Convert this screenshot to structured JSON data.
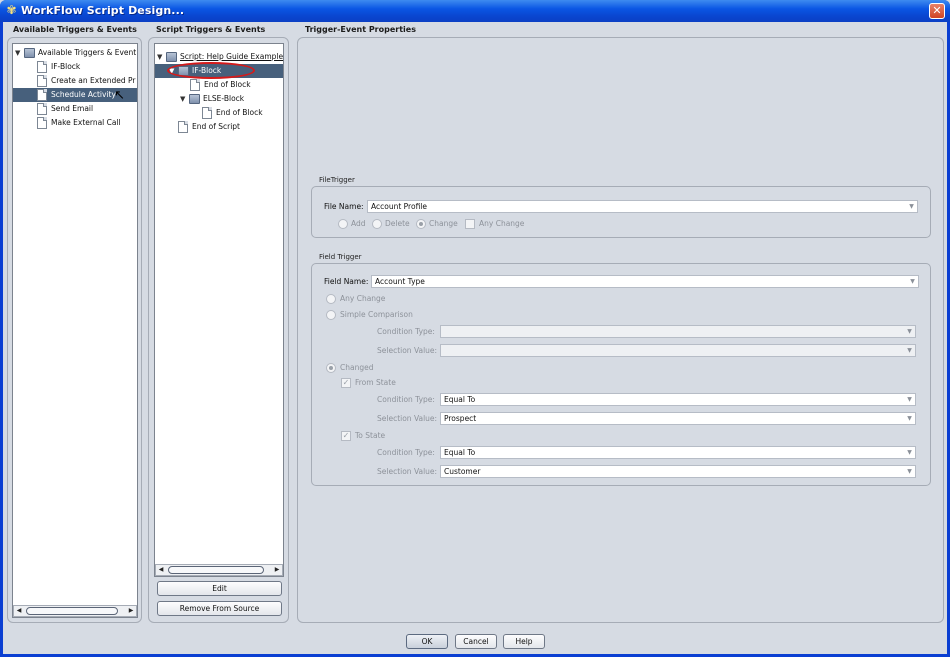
{
  "window": {
    "title": "WorkFlow Script Design..."
  },
  "left_panel": {
    "header": "Available Triggers & Events",
    "root": "Available Triggers & Event",
    "items": [
      "IF-Block",
      "Create an Extended Pr",
      "Schedule Activity",
      "Send Email",
      "Make External Call"
    ],
    "selected_index": 2
  },
  "middle_panel": {
    "header": "Script Triggers & Events",
    "script_root": "Script: Help Guide Example",
    "if_block": "IF-Block",
    "if_end": "End of Block",
    "else_block": "ELSE-Block",
    "else_end": "End of Block",
    "end_script": "End of Script",
    "edit_button": "Edit",
    "remove_button": "Remove From Source"
  },
  "properties": {
    "header": "Trigger-Event Properties",
    "file_trigger": {
      "legend": "FileTrigger",
      "file_name_label": "File Name:",
      "file_name_value": "Account Profile",
      "options": [
        "Add",
        "Delete",
        "Change"
      ],
      "selected_option": "Change",
      "any_change_label": "Any Change"
    },
    "field_trigger": {
      "legend": "Field Trigger",
      "field_name_label": "Field Name:",
      "field_name_value": "Account Type",
      "any_change_label": "Any Change",
      "simple_comparison_label": "Simple Comparison",
      "condition_type_label": "Condition Type:",
      "selection_value_label": "Selection Value:",
      "changed_label": "Changed",
      "from_state_label": "From State",
      "from_condition_value": "Equal To",
      "from_selection_value": "Prospect",
      "to_state_label": "To State",
      "to_condition_value": "Equal To",
      "to_selection_value": "Customer"
    }
  },
  "footer": {
    "ok": "OK",
    "cancel": "Cancel",
    "help": "Help"
  }
}
